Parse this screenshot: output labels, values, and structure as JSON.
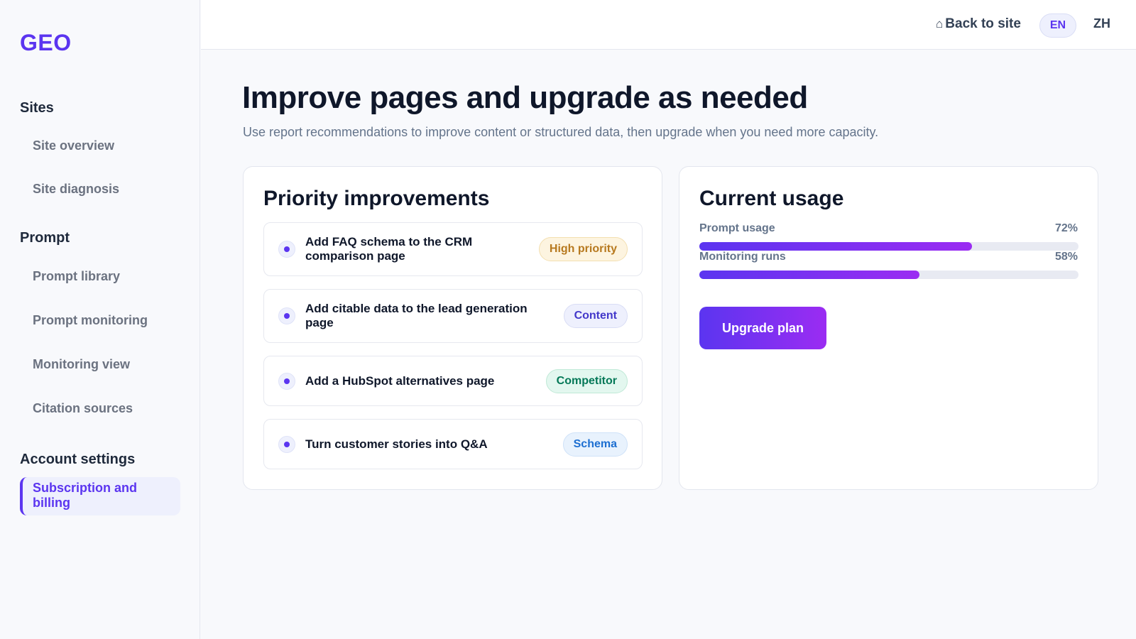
{
  "app": {
    "logo": "GEO"
  },
  "sidebar": {
    "sections": [
      {
        "title": "Sites",
        "items": [
          "Site overview",
          "Site diagnosis"
        ]
      },
      {
        "title": "Prompt",
        "items": [
          "Prompt library",
          "Prompt monitoring",
          "Monitoring view",
          "Citation sources"
        ]
      },
      {
        "title": "Account settings",
        "items": [
          "Subscription and billing"
        ]
      }
    ],
    "active_item": "Subscription and billing"
  },
  "topbar": {
    "back_label": "Back to site",
    "languages": [
      "EN",
      "ZH"
    ],
    "active_language": "EN"
  },
  "page": {
    "title": "Improve pages and upgrade as needed",
    "subtitle": "Use report recommendations to improve content or structured data, then upgrade when you need more capacity."
  },
  "improvements": {
    "title": "Priority improvements",
    "items": [
      {
        "text": "Add FAQ schema to the CRM comparison page",
        "badge": "High priority",
        "badge_color": "#b7791f",
        "badge_bg": "#fdf4e0",
        "badge_border": "#f3dfb0"
      },
      {
        "text": "Add citable data to the lead generation page",
        "badge": "Content",
        "badge_color": "#4338ca",
        "badge_bg": "#eef0fd",
        "badge_border": "#d9ddf5"
      },
      {
        "text": "Add a HubSpot alternatives page",
        "badge": "Competitor",
        "badge_color": "#047857",
        "badge_bg": "#e3f7ef",
        "badge_border": "#bfe9d6"
      },
      {
        "text": "Turn customer stories into Q&A",
        "badge": "Schema",
        "badge_color": "#1d6fd1",
        "badge_bg": "#e8f2fd",
        "badge_border": "#cfe2f8"
      }
    ]
  },
  "usage": {
    "title": "Current usage",
    "metrics": [
      {
        "label": "Prompt usage",
        "percent_label": "72%",
        "value": 0.72
      },
      {
        "label": "Monitoring runs",
        "percent_label": "58%",
        "value": 0.58
      }
    ],
    "upgrade_label": "Upgrade plan"
  },
  "colors": {
    "accent": "#5b35f0",
    "accent_gradient_end": "#9b2cf2"
  }
}
